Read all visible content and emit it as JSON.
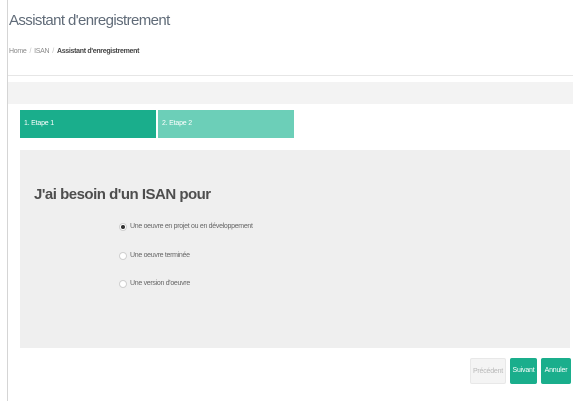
{
  "header": {
    "title": "Assistant d'enregistrement",
    "breadcrumb": {
      "home": "Home",
      "separator": "/",
      "section": "ISAN",
      "current": "Assistant d'enregistrement"
    }
  },
  "steps": [
    {
      "label": "1. Etape 1",
      "active": true
    },
    {
      "label": "2. Etape 2",
      "active": false
    }
  ],
  "wizard": {
    "question": "J'ai besoin d'un ISAN pour",
    "options": [
      {
        "label": "Une oeuvre en projet ou en développement",
        "checked": true
      },
      {
        "label": "Une oeuvre terminée",
        "checked": false
      },
      {
        "label": "Une version d'oeuvre",
        "checked": false
      }
    ]
  },
  "actions": {
    "previous": "Précédent",
    "next": "Suivant",
    "cancel": "Annuler"
  },
  "colors": {
    "accent": "#1aae8c",
    "accent_light": "#6ccfb8",
    "panel": "#efefef"
  }
}
